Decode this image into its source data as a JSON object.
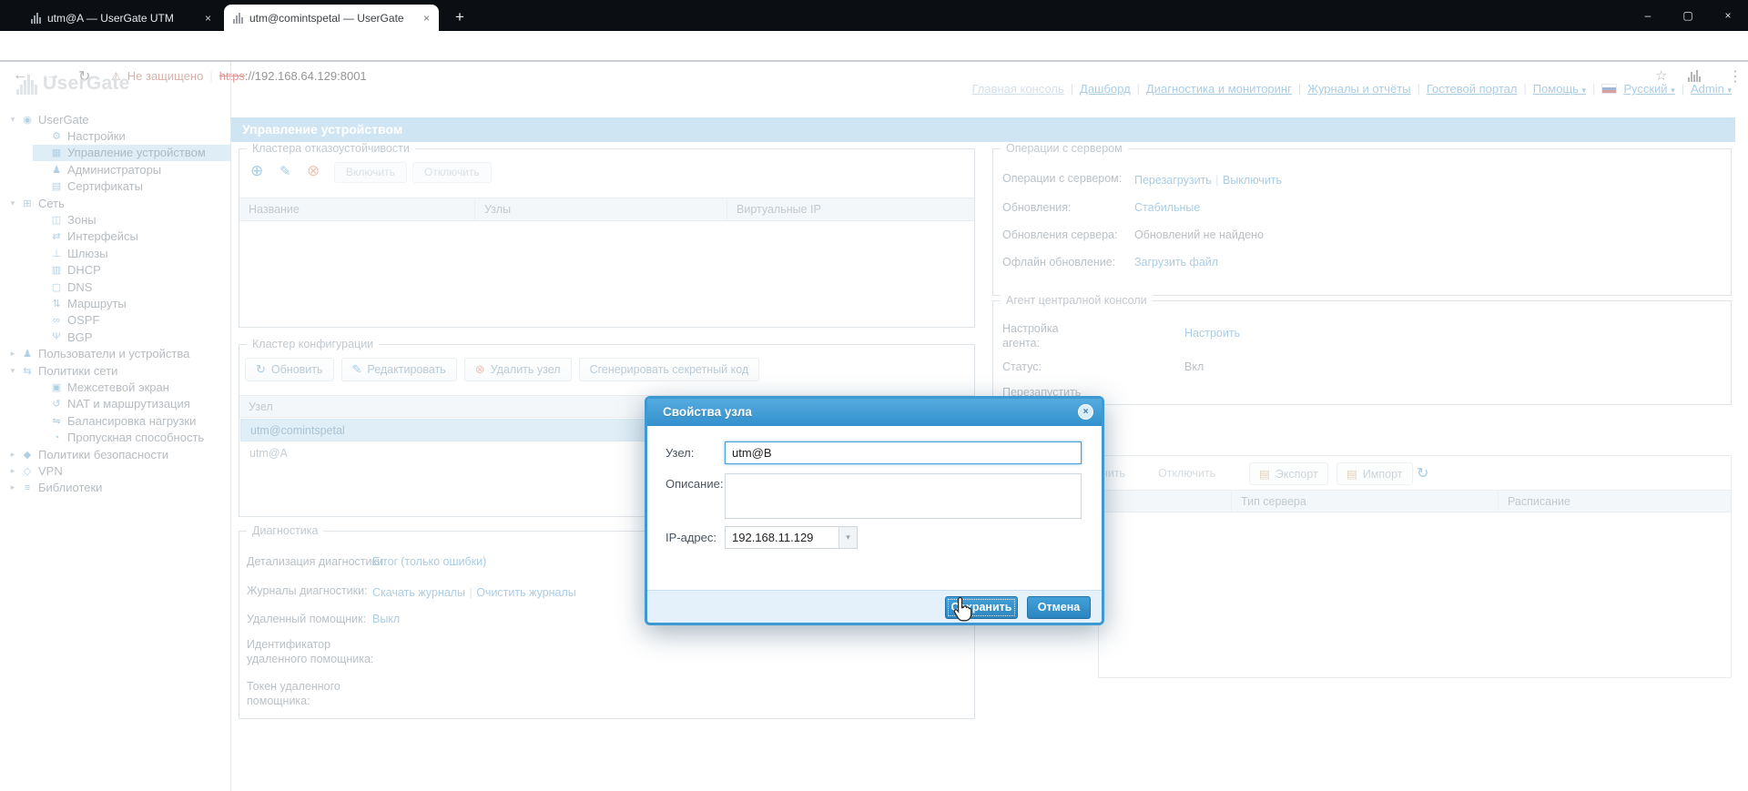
{
  "colors": {
    "accent": "#3d99d3",
    "link": "#4e96c6",
    "selection": "#dfedf7",
    "warning_text": "#a85c4d",
    "strike_red": "#c5221f",
    "titlebar": "#cde4f2"
  },
  "browser": {
    "tabs": [
      {
        "title": "utm@A — UserGate UTM",
        "close": "×"
      },
      {
        "title": "utm@comintspetal — UserGate U",
        "close": "×"
      }
    ],
    "new_tab": "+",
    "nav": {
      "back": "←",
      "forward": "→",
      "reload": "↻"
    },
    "address": {
      "warning": "⚠",
      "not_secure": "Не защищено",
      "scheme": "https",
      "rest": "://192.168.64.129:8001",
      "star": "☆",
      "menu": "⋮"
    },
    "window": {
      "minimize": "–",
      "maximize": "▢",
      "close": "×"
    }
  },
  "header": {
    "logo": "UserGate",
    "links": [
      "Главная консоль",
      "Дашборд",
      "Диагностика и мониторинг",
      "Журналы и отчёты",
      "Гостевой портал"
    ],
    "help": "Помощь",
    "lang": "Русский",
    "user": "Admin",
    "caret": "▾",
    "sep": "|"
  },
  "sidebar": {
    "items": [
      {
        "arrow": "▾",
        "glyph": "◉",
        "label": "UserGate"
      },
      {
        "arrow": "",
        "glyph": "⚙",
        "label": "Настройки"
      },
      {
        "arrow": "",
        "glyph": "▦",
        "label": "Управление устройством"
      },
      {
        "arrow": "",
        "glyph": "♟",
        "label": "Администраторы"
      },
      {
        "arrow": "",
        "glyph": "▤",
        "label": "Сертификаты"
      },
      {
        "arrow": "▾",
        "glyph": "⊞",
        "label": "Сеть"
      },
      {
        "arrow": "",
        "glyph": "◫",
        "label": "Зоны"
      },
      {
        "arrow": "",
        "glyph": "⇄",
        "label": "Интерфейсы"
      },
      {
        "arrow": "",
        "glyph": "⊥",
        "label": "Шлюзы"
      },
      {
        "arrow": "",
        "glyph": "▥",
        "label": "DHCP"
      },
      {
        "arrow": "",
        "glyph": "▢",
        "label": "DNS"
      },
      {
        "arrow": "",
        "glyph": "⇅",
        "label": "Маршруты"
      },
      {
        "arrow": "",
        "glyph": "∞",
        "label": "OSPF"
      },
      {
        "arrow": "",
        "glyph": "Ψ",
        "label": "BGP"
      },
      {
        "arrow": "▸",
        "glyph": "♟",
        "label": "Пользователи и устройства"
      },
      {
        "arrow": "▾",
        "glyph": "⇆",
        "label": "Политики сети"
      },
      {
        "arrow": "",
        "glyph": "▣",
        "label": "Межсетевой экран"
      },
      {
        "arrow": "",
        "glyph": "↺",
        "label": "NAT и маршрутизация"
      },
      {
        "arrow": "",
        "glyph": "⇋",
        "label": "Балансировка нагрузки"
      },
      {
        "arrow": "",
        "glyph": "◔",
        "label": "Пропускная способность"
      },
      {
        "arrow": "▸",
        "glyph": "◆",
        "label": "Политики безопасности"
      },
      {
        "arrow": "▸",
        "glyph": "◇",
        "label": "VPN"
      },
      {
        "arrow": "▸",
        "glyph": "≡",
        "label": "Библиотеки"
      }
    ]
  },
  "page": {
    "title": "Управление устройством"
  },
  "failover": {
    "legend": "Кластера отказоустойчивости",
    "add": "⊕",
    "edit": "✎",
    "remove": "⊗",
    "enable": "Включить",
    "disable": "Отключить",
    "columns": [
      "Название",
      "Узлы",
      "Виртуальные IP"
    ]
  },
  "cluster": {
    "legend": "Кластер конфигурации",
    "refresh_icon": "↻",
    "refresh_label": "Обновить",
    "edit_icon": "✎",
    "edit_label": "Редактировать",
    "remove_icon": "⊗",
    "remove_label": "Удалить узел",
    "generate_label": "Сгенерировать секретный код",
    "column": "Узел",
    "rows": [
      "utm@comintspetal",
      "utm@A"
    ]
  },
  "diag": {
    "legend": "Диагностика",
    "r1_label": "Детализация диагностики:",
    "r1_value": "Error (только ошибки)",
    "r2_label": "Журналы диагностики:",
    "r2_link1": "Скачать журналы",
    "r2_link2": "Очистить журналы",
    "r3_label": "Удаленный помощник:",
    "r3_value": "Выкл",
    "r4_label": "Идентификатор удаленного помощника:",
    "r5_label": "Токен удаленного помощника:",
    "sep": "|"
  },
  "ops": {
    "legend": "Операции с сервером",
    "r1_label": "Операции с сервером:",
    "r1_link1": "Перезагрузить",
    "r1_link2": "Выключить",
    "r2_label": "Обновления:",
    "r2_value": "Стабильные",
    "r3_label": "Обновления сервера:",
    "r3_value": "Обновлений не найдено",
    "r4_label": "Офлайн обновление:",
    "r4_value": "Загрузить файл",
    "sep": "|"
  },
  "agent": {
    "legend": "Агент централной консоли",
    "r1_label": "Настройка агента:",
    "r1_value": "Настроить",
    "r2_label": "Статус:",
    "r2_value": "Вкл",
    "r3_label": "Перезапустить"
  },
  "servers": {
    "enable": "Включить",
    "disable": "Отключить",
    "export_icon": "▤",
    "export_label": "Экспорт",
    "import_icon": "▤",
    "import_label": "Импорт",
    "refresh": "↻",
    "col2": "Тип сервера",
    "col3": "Расписание"
  },
  "modal": {
    "title": "Свойства узла",
    "close": "×",
    "node_label": "Узел:",
    "node_value": "utm@B",
    "desc_label": "Описание:",
    "ip_label": "IP-адрес:",
    "ip_value": "192.168.11.129",
    "ip_caret": "▾",
    "save": "Сохранить",
    "cancel": "Отмена"
  }
}
